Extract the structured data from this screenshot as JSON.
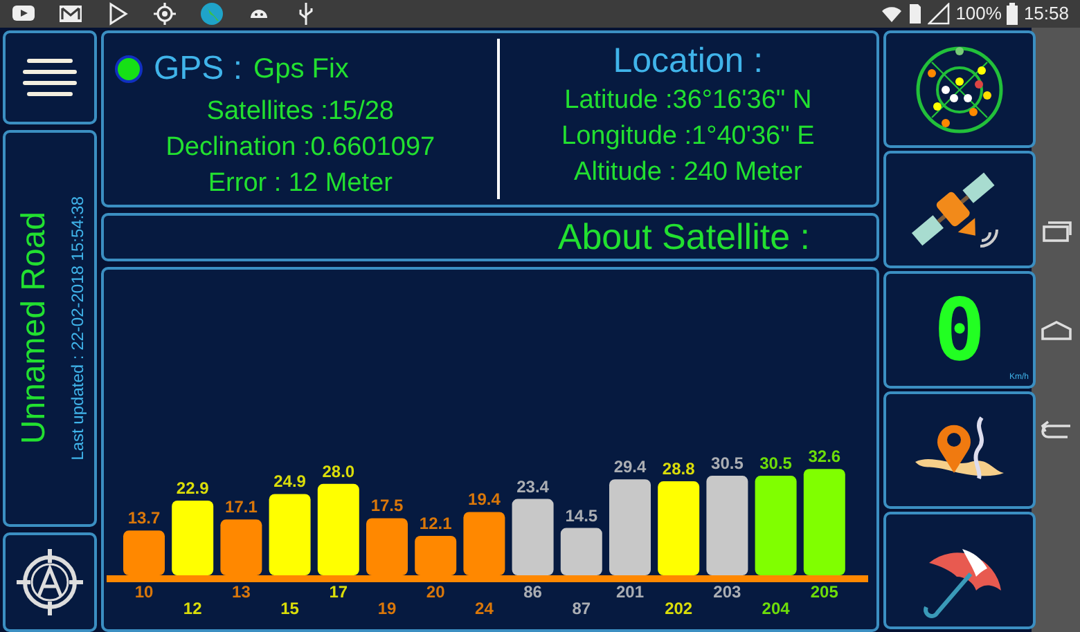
{
  "status_bar": {
    "battery": "100%",
    "time": "15:58"
  },
  "road": {
    "name": "Unnamed Road",
    "updated": "Last updated : 22-02-2018 15:54:38"
  },
  "gps": {
    "label": "GPS :",
    "status": "Gps Fix",
    "color": "#16e016",
    "lines": [
      "Satellites :15/28",
      "Declination :0.6601097",
      "Error : 12 Meter"
    ]
  },
  "location": {
    "title": "Location :",
    "lines": [
      "Latitude :36°16'36\" N",
      "Longitude :1°40'36\" E",
      "Altitude : 240 Meter"
    ]
  },
  "about": {
    "title": "About Satellite :"
  },
  "chart": {
    "chart_data": {
      "type": "bar",
      "stacked": true,
      "categories": [
        "10",
        "12",
        "13",
        "15",
        "17",
        "19",
        "20",
        "24",
        "86",
        "87",
        "201",
        "202",
        "203",
        "204",
        "205"
      ],
      "series": [
        {
          "color": "#ff8800",
          "values": [
            13.7,
            null,
            17.1,
            null,
            null,
            17.5,
            12.1,
            19.4,
            null,
            null,
            null,
            null,
            null,
            null,
            null
          ],
          "value_labels": [
            "13.7",
            null,
            "17.1",
            null,
            null,
            "17.5",
            "12.1",
            "19.4",
            null,
            null,
            null,
            null,
            null,
            null,
            null
          ]
        },
        {
          "color": "#ffff00",
          "values": [
            null,
            22.9,
            null,
            24.9,
            28.0,
            null,
            null,
            null,
            null,
            null,
            null,
            28.8,
            null,
            null,
            null
          ],
          "value_labels": [
            null,
            "22.9",
            null,
            "24.9",
            "28.0",
            null,
            null,
            null,
            null,
            null,
            null,
            "28.8",
            null,
            null,
            null
          ]
        },
        {
          "color": "#c8c8c8",
          "values": [
            null,
            null,
            null,
            null,
            null,
            null,
            null,
            null,
            23.4,
            14.5,
            29.4,
            null,
            30.5,
            null,
            null
          ],
          "value_labels": [
            null,
            null,
            null,
            null,
            null,
            null,
            null,
            null,
            "23.4",
            "14.5",
            "29.4",
            null,
            "30.5",
            null,
            null
          ]
        },
        {
          "color": "#80ff00",
          "values": [
            null,
            null,
            null,
            null,
            null,
            null,
            null,
            null,
            null,
            null,
            null,
            null,
            null,
            30.5,
            32.6
          ],
          "value_labels": [
            null,
            null,
            null,
            null,
            null,
            null,
            null,
            null,
            null,
            null,
            null,
            null,
            null,
            "30.5",
            "32.6"
          ]
        }
      ]
    }
  },
  "speed": {
    "value": "0",
    "unit": "Km/h"
  }
}
